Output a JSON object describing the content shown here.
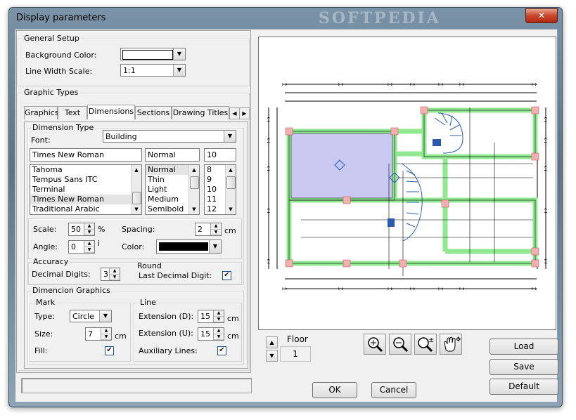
{
  "window": {
    "title": "Display parameters",
    "watermark": "SOFTPEDIA",
    "close_glyph": "✕"
  },
  "general": {
    "legend": "General Setup",
    "bg_color_label": "Background Color:",
    "bg_color_value": "#ffffff",
    "line_width_label": "Line Width Scale:",
    "line_width_value": "1:1"
  },
  "graphic_types": {
    "legend": "Graphic Types",
    "tabs": [
      "Graphics",
      "Text",
      "Dimensions",
      "Sections",
      "Drawing Titles"
    ],
    "active_tab": "Dimensions"
  },
  "dimension_type": {
    "legend": "Dimension Type",
    "font_label": "Font:",
    "type_value": "Building",
    "font_name": "Times New Roman",
    "font_style": "Normal",
    "font_size": "10",
    "fonts": [
      "Tahoma",
      "Tempus Sans ITC",
      "Terminal",
      "Times New Roman",
      "Traditional Arabic"
    ],
    "styles": [
      "Normal",
      "Thin",
      "Light",
      "Medium",
      "Semibold"
    ],
    "sizes": [
      "8",
      "9",
      "10",
      "11",
      "12"
    ],
    "scale_label": "Scale:",
    "scale_value": "50",
    "scale_unit": "%",
    "spacing_label": "Spacing:",
    "spacing_value": "2",
    "spacing_unit": "cm",
    "angle_label": "Angle:",
    "angle_value": "0",
    "angle_unit": "i",
    "color_label": "Color:",
    "color_value": "#000000"
  },
  "accuracy": {
    "legend": "Accuracy",
    "decimal_label": "Decimal Digits:",
    "decimal_value": "3",
    "round_label": "Round",
    "last_decimal_label": "Last Decimal Digit:",
    "last_decimal_checked": true
  },
  "dim_graphics": {
    "legend": "Dimencion Graphics",
    "mark_legend": "Mark",
    "type_label": "Type:",
    "type_value": "Circle",
    "size_label": "Size:",
    "size_value": "7",
    "size_unit": "cm",
    "fill_label": "Fill:",
    "fill_checked": true,
    "line_legend": "Line",
    "ext_d_label": "Extension (D):",
    "ext_d_value": "15",
    "ext_d_unit": "cm",
    "ext_u_label": "Extension (U):",
    "ext_u_value": "15",
    "ext_u_unit": "cm",
    "aux_label": "Auxiliary Lines:",
    "aux_checked": true
  },
  "status": {
    "text": ""
  },
  "floor": {
    "label": "Floor",
    "value": "1"
  },
  "tools": [
    "zoom-in-icon",
    "zoom-out-icon",
    "zoom-fit-icon",
    "pan-hand-icon"
  ],
  "buttons": {
    "ok": "OK",
    "cancel": "Cancel",
    "load": "Load",
    "save": "Save",
    "default": "Default"
  },
  "colors": {
    "room_fill": "#c8c8f0",
    "wall": "#90e890",
    "column": "#f4b0b0",
    "stair": "#2a5ab0"
  }
}
